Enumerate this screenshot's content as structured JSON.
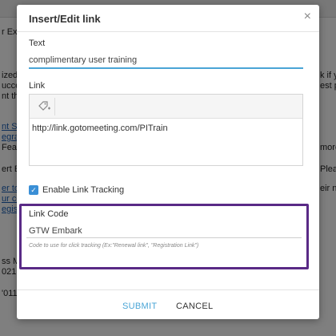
{
  "background": {
    "fragments": [
      "r Exp",
      "ized to",
      "ucce",
      "nt tha",
      "nt Se",
      "egrati",
      "Featu",
      "ert Ev",
      "er to",
      "ur co",
      "egistr",
      "ss M",
      "021",
      "'011",
      "k if yo",
      "est pr",
      "more",
      "Plea",
      "eir ne"
    ]
  },
  "modal": {
    "title": "Insert/Edit link",
    "close_glyph": "×",
    "text_label": "Text",
    "text_value": "complimentary user training",
    "link_label": "Link",
    "link_url": "http://link.gotomeeting.com/PITrain",
    "tracking_label": "Enable Link Tracking",
    "tracking_checked": true,
    "link_code_label": "Link Code",
    "link_code_value": "GTW Embark",
    "link_code_hint": "Code to use for click tracking (Ex:\"Renewal link\", \"Registration Link\")",
    "submit_label": "SUBMIT",
    "cancel_label": "CANCEL"
  },
  "colors": {
    "accent": "#4aa5d6",
    "highlight_border": "#5a2a86",
    "checkbox": "#3a8fd6"
  },
  "icons": {
    "tag": "tag-plus-icon",
    "check": "check-icon",
    "close": "close-icon"
  }
}
